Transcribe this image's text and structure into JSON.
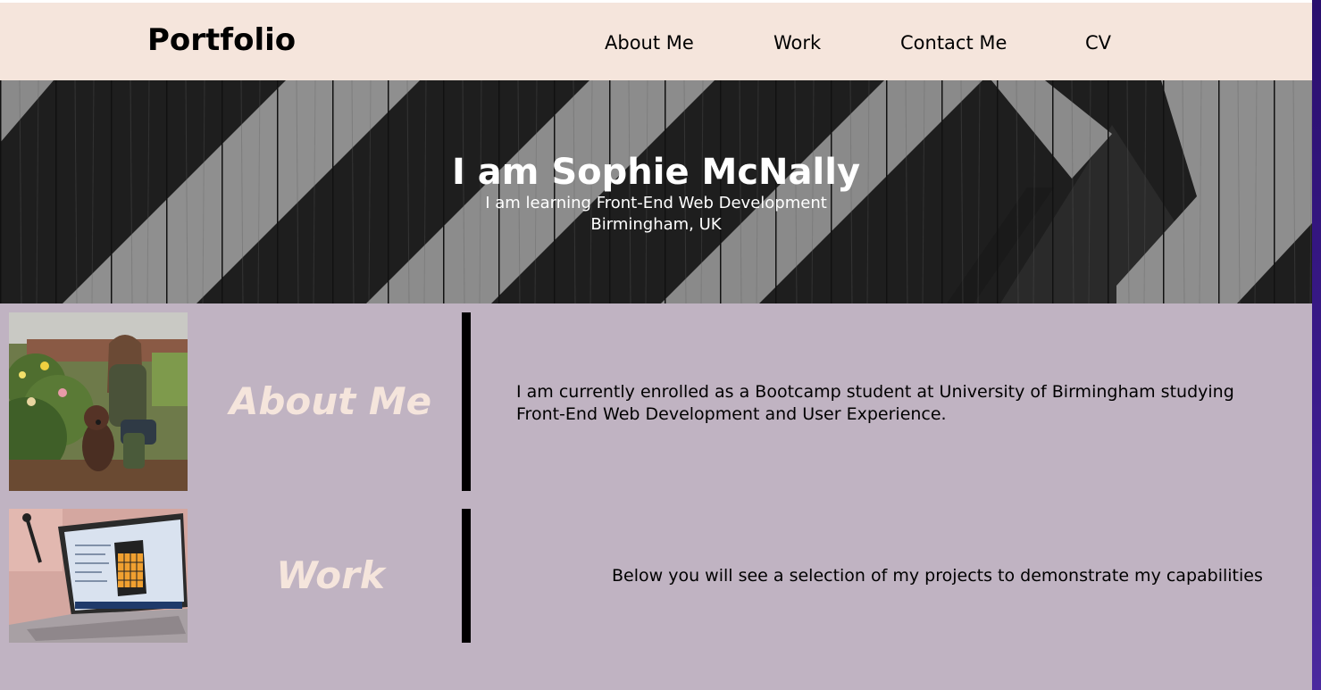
{
  "header": {
    "brand": "Portfolio",
    "nav": [
      "About Me",
      "Work",
      "Contact Me",
      "CV"
    ]
  },
  "hero": {
    "title": "I am Sophie McNally",
    "subtitle": "I am learning Front-End Web Development",
    "location": "Birmingham, UK"
  },
  "about": {
    "heading": "About Me",
    "text_line1": "I am currently enrolled as a Bootcamp student at University of Birmingham studying",
    "text_line2": "Front-End Web Development and User Experience."
  },
  "work": {
    "heading": "Work",
    "text": "Below you will see a selection of my projects to demonstrate my capabilities"
  },
  "colors": {
    "header_bg": "#f5e5dc",
    "page_bg": "#c0b3c2",
    "heading": "#f5e5dc",
    "divider": "#000000"
  }
}
